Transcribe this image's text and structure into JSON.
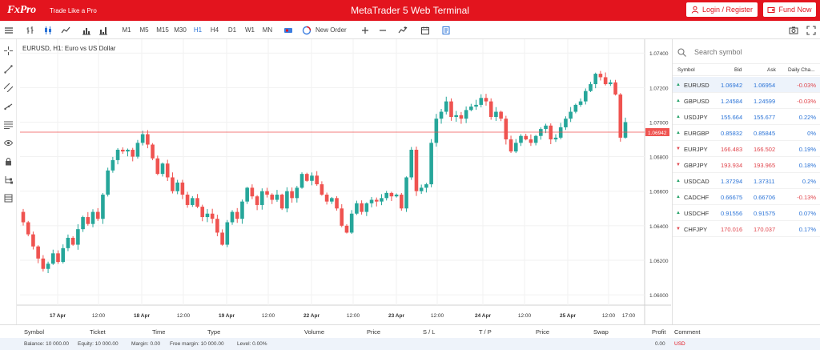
{
  "header": {
    "brand": "FxPro",
    "tagline": "Trade Like a Pro",
    "title": "MetaTrader 5 Web Terminal",
    "login_label": "Login / Register",
    "fund_label": "Fund Now",
    "brand_color": "#e3141e"
  },
  "toolbar": {
    "timeframes": [
      "M1",
      "M5",
      "M15",
      "M30",
      "H1",
      "H4",
      "D1",
      "W1",
      "MN"
    ],
    "active_timeframe": "H1",
    "new_order_label": "New Order",
    "icons": [
      "menu-icon",
      "bar-chart-icon",
      "candlestick-icon",
      "line-chart-icon",
      "volume-icon",
      "volume-alt-icon",
      "depth-of-market-icon",
      "new-order-icon",
      "zoom-in-icon",
      "zoom-out-icon",
      "indicators-icon",
      "calendar-icon",
      "notes-icon",
      "screenshot-icon",
      "fullscreen-icon"
    ]
  },
  "sidebar_icons": [
    "crosshair-icon",
    "trendline-icon",
    "parallel-lines-icon",
    "ray-icon",
    "fibonacci-icon",
    "eye-icon",
    "lock-icon",
    "objects-tree-icon",
    "layers-icon"
  ],
  "chart": {
    "title": "EURUSD, H1: Euro vs US Dollar",
    "current_price_label": "1.06942"
  },
  "chart_data": {
    "type": "candlestick",
    "symbol": "EURUSD",
    "timeframe": "H1",
    "title": "EURUSD, H1: Euro vs US Dollar",
    "y_ticks": [
      "1.07400",
      "1.07200",
      "1.07000",
      "1.06800",
      "1.06600",
      "1.06400",
      "1.06200",
      "1.06000"
    ],
    "ylim": [
      1.0594,
      1.0748
    ],
    "x_ticks": [
      "17 Apr",
      "12:00",
      "18 Apr",
      "12:00",
      "19 Apr",
      "12:00",
      "22 Apr",
      "12:00",
      "23 Apr",
      "12:00",
      "24 Apr",
      "12:00",
      "25 Apr",
      "12:00",
      "17:00"
    ],
    "current_price": 1.06942,
    "up_color": "#26a69a",
    "down_color": "#ef5350",
    "closes": [
      1.0642,
      1.0635,
      1.0628,
      1.0621,
      1.0615,
      1.0618,
      1.0624,
      1.0619,
      1.0627,
      1.0633,
      1.0629,
      1.0638,
      1.0645,
      1.0641,
      1.0648,
      1.0644,
      1.0658,
      1.0672,
      1.0678,
      1.0684,
      1.0683,
      1.0684,
      1.068,
      1.0688,
      1.0693,
      1.0687,
      1.0679,
      1.067,
      1.0676,
      1.0668,
      1.066,
      1.0665,
      1.0658,
      1.0652,
      1.0656,
      1.0651,
      1.0645,
      1.0647,
      1.0644,
      1.0636,
      1.0629,
      1.0642,
      1.0648,
      1.0644,
      1.0654,
      1.0662,
      1.0657,
      1.0652,
      1.066,
      1.0658,
      1.0655,
      1.0658,
      1.065,
      1.066,
      1.0656,
      1.0662,
      1.067,
      1.0666,
      1.0669,
      1.0664,
      1.0658,
      1.0654,
      1.0656,
      1.065,
      1.064,
      1.0636,
      1.0647,
      1.0653,
      1.0648,
      1.0653,
      1.0655,
      1.0654,
      1.0656,
      1.0659,
      1.0657,
      1.0658,
      1.065,
      1.0668,
      1.0684,
      1.066,
      1.0662,
      1.0664,
      1.0688,
      1.0702,
      1.0706,
      1.0712,
      1.0703,
      1.0704,
      1.0702,
      1.0707,
      1.0709,
      1.071,
      1.0714,
      1.0712,
      1.0703,
      1.0706,
      1.0702,
      1.069,
      1.0683,
      1.0688,
      1.0692,
      1.069,
      1.0688,
      1.0692,
      1.0696,
      1.0698,
      1.069,
      1.0691,
      1.0697,
      1.0702,
      1.0706,
      1.071,
      1.0712,
      1.0718,
      1.0722,
      1.0728,
      1.0726,
      1.0722,
      1.0723,
      1.0716,
      1.0691,
      1.07
    ],
    "series": [
      {
        "name": "EURUSD",
        "type": "candlestick"
      }
    ]
  },
  "market_watch": {
    "search_placeholder": "Search symbol",
    "columns": [
      "Symbol",
      "Bid",
      "Ask",
      "Daily Cha..."
    ],
    "rows": [
      {
        "symbol": "EURUSD",
        "bid": "1.06942",
        "ask": "1.06954",
        "change": "-0.03%",
        "dir": "up",
        "selected": true
      },
      {
        "symbol": "GBPUSD",
        "bid": "1.24584",
        "ask": "1.24599",
        "change": "-0.03%",
        "dir": "up",
        "selected": false
      },
      {
        "symbol": "USDJPY",
        "bid": "155.664",
        "ask": "155.677",
        "change": "0.22%",
        "dir": "up",
        "selected": false
      },
      {
        "symbol": "EURGBP",
        "bid": "0.85832",
        "ask": "0.85845",
        "change": "0%",
        "dir": "up",
        "selected": false
      },
      {
        "symbol": "EURJPY",
        "bid": "166.483",
        "ask": "166.502",
        "change": "0.19%",
        "dir": "down",
        "selected": false
      },
      {
        "symbol": "GBPJPY",
        "bid": "193.934",
        "ask": "193.965",
        "change": "0.18%",
        "dir": "down",
        "selected": false
      },
      {
        "symbol": "USDCAD",
        "bid": "1.37294",
        "ask": "1.37311",
        "change": "0.2%",
        "dir": "up",
        "selected": false
      },
      {
        "symbol": "CADCHF",
        "bid": "0.66675",
        "ask": "0.66706",
        "change": "-0.13%",
        "dir": "up",
        "selected": false
      },
      {
        "symbol": "USDCHF",
        "bid": "0.91556",
        "ask": "0.91575",
        "change": "0.07%",
        "dir": "up",
        "selected": false
      },
      {
        "symbol": "CHFJPY",
        "bid": "170.016",
        "ask": "170.037",
        "change": "0.17%",
        "dir": "down",
        "selected": false
      }
    ]
  },
  "trade": {
    "columns": [
      "Symbol",
      "Ticket",
      "Time",
      "Type",
      "Volume",
      "Price",
      "S / L",
      "T / P",
      "Price",
      "Swap",
      "Profit",
      "Comment"
    ],
    "balance_text": "Balance: 10 000.00",
    "equity_text": "Equity: 10 000.00",
    "margin_text": "Margin: 0.00",
    "free_margin_text": "Free margin: 10 000.00",
    "level_text": "Level: 0.00%",
    "profit_total": "0.00",
    "currency": "USD"
  }
}
